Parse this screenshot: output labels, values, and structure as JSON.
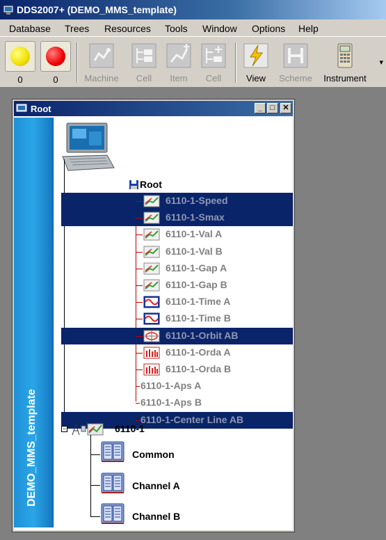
{
  "app": {
    "title": "DDS2007+ (DEMO_MMS_template)"
  },
  "menu": [
    "Database",
    "Trees",
    "Resources",
    "Tools",
    "Window",
    "Options",
    "Help"
  ],
  "toolbar": {
    "counter_yellow": "0",
    "counter_red": "0",
    "buttons": [
      {
        "label": "Machine",
        "enabled": false
      },
      {
        "label": "Cell",
        "enabled": false
      },
      {
        "label": "Item",
        "enabled": false
      },
      {
        "label": "Cell",
        "enabled": false
      },
      {
        "label": "View",
        "enabled": true
      },
      {
        "label": "Scheme",
        "enabled": false
      },
      {
        "label": "Instrument",
        "enabled": true
      }
    ]
  },
  "window": {
    "title": "Root",
    "banner": "DEMO_MMS_template",
    "root_label": "Root",
    "points": [
      {
        "label": "6110-1-Speed",
        "selected": true,
        "icon": "trend-icon"
      },
      {
        "label": "6110-1-Smax",
        "selected": true,
        "icon": "trend-icon"
      },
      {
        "label": "6110-1-Val A",
        "selected": false,
        "icon": "trend-icon"
      },
      {
        "label": "6110-1-Val B",
        "selected": false,
        "icon": "trend-icon"
      },
      {
        "label": "6110-1-Gap A",
        "selected": false,
        "icon": "trend-icon"
      },
      {
        "label": "6110-1-Gap B",
        "selected": false,
        "icon": "trend-icon"
      },
      {
        "label": "6110-1-Time A",
        "selected": false,
        "icon": "waveform-icon"
      },
      {
        "label": "6110-1-Time B",
        "selected": false,
        "icon": "waveform-icon"
      },
      {
        "label": "6110-1-Orbit AB",
        "selected": true,
        "icon": "orbit-icon"
      },
      {
        "label": "6110-1-Orda A",
        "selected": false,
        "icon": "spectrum-icon"
      },
      {
        "label": "6110-1-Orda B",
        "selected": false,
        "icon": "spectrum-icon"
      },
      {
        "label": "6110-1-Aps A",
        "selected": false,
        "icon": ""
      },
      {
        "label": "6110-1-Aps B",
        "selected": false,
        "icon": ""
      },
      {
        "label": "6110-1-Center Line AB",
        "selected": true,
        "icon": ""
      }
    ],
    "machine_label": "6110-1",
    "cells": [
      "Common",
      "Channel A",
      "Channel B"
    ]
  }
}
